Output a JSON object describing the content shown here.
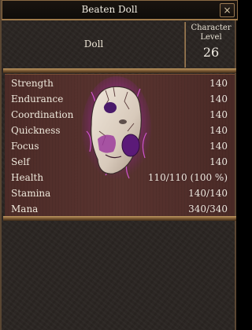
{
  "window": {
    "title": "Beaten Doll",
    "close_glyph": "×"
  },
  "header": {
    "item_name": "Doll",
    "level_label_line1": "Character",
    "level_label_line2": "Level",
    "level_value": "26"
  },
  "stats": [
    {
      "label": "Strength",
      "value": "140"
    },
    {
      "label": "Endurance",
      "value": "140"
    },
    {
      "label": "Coordination",
      "value": "140"
    },
    {
      "label": "Quickness",
      "value": "140"
    },
    {
      "label": "Focus",
      "value": "140"
    },
    {
      "label": "Self",
      "value": "140"
    },
    {
      "label": "Health",
      "value": "110/110 (100 %)"
    },
    {
      "label": "Stamina",
      "value": "140/140"
    },
    {
      "label": "Mana",
      "value": "340/340"
    }
  ],
  "portrait": {
    "icon": "cracked-doll-mask-icon",
    "glow_color": "#d63cdc",
    "mask_color": "#ddd0c2",
    "spot_color": "#5b1a78"
  }
}
